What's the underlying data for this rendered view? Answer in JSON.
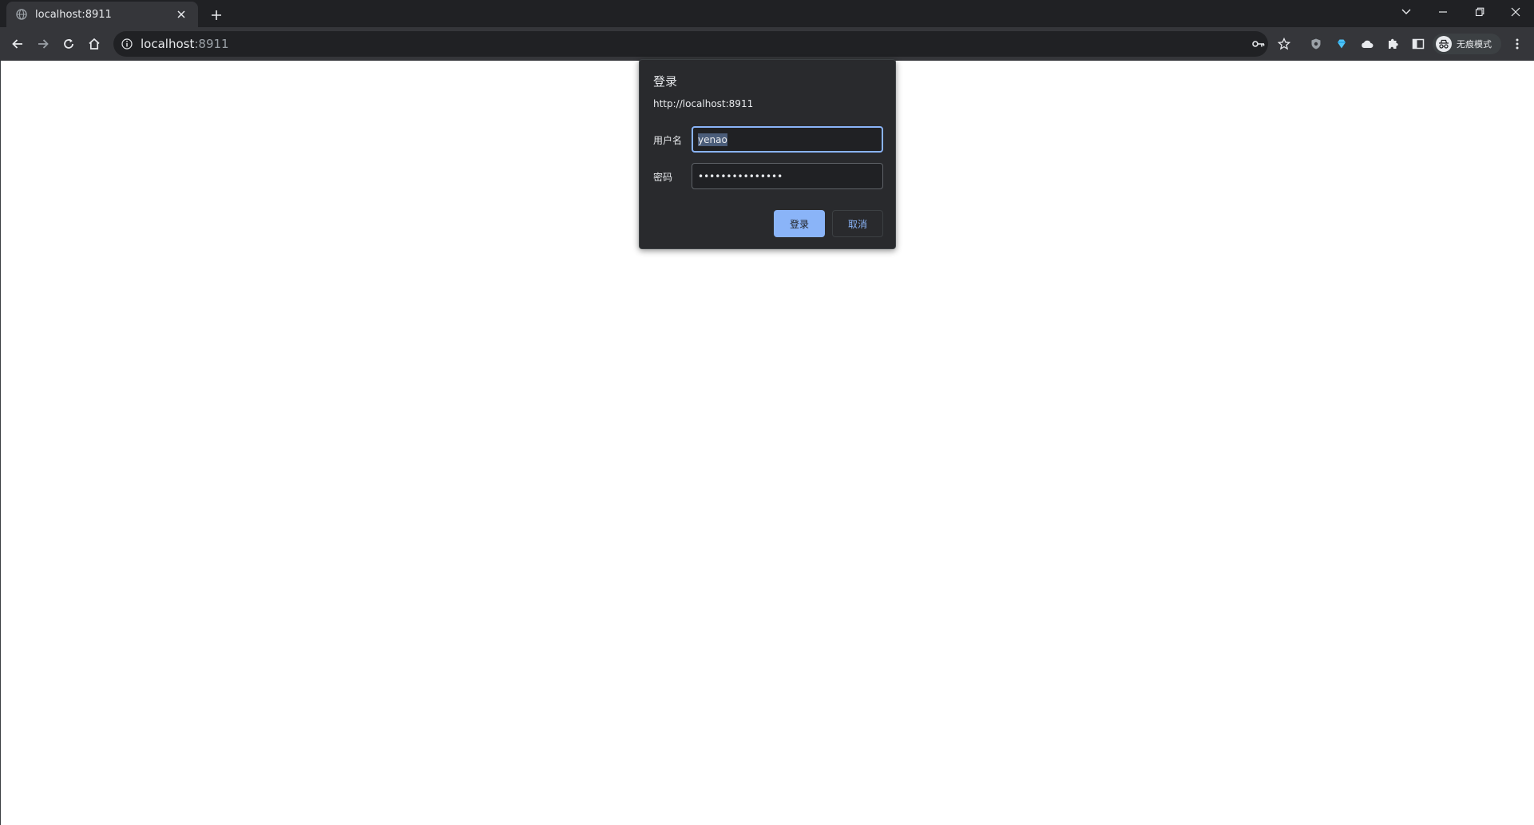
{
  "browser": {
    "tab": {
      "title": "localhost:8911",
      "favicon": "globe-icon"
    },
    "new_tab_symbol": "+",
    "address": {
      "host": "localhost",
      "port": ":8911"
    },
    "profile_label": "无痕模式"
  },
  "dialog": {
    "title": "登录",
    "origin": "http://localhost:8911",
    "username_label": "用户名",
    "username_value": "yenao",
    "password_label": "密码",
    "password_mask": "•••••••••••••••",
    "login_button": "登录",
    "cancel_button": "取消"
  },
  "colors": {
    "accent": "#8ab4f8",
    "dialog_bg": "#292a2d",
    "toolbar_bg": "#35363a",
    "frame_bg": "#202124"
  }
}
